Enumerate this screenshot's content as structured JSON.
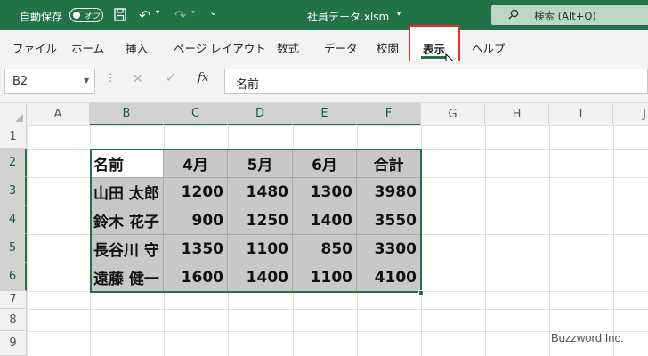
{
  "titlebar": {
    "autosave_label": "自動保存",
    "autosave_state": "オフ",
    "document_title": "社員データ.xlsm",
    "search_text": "検索 (Alt+Q)"
  },
  "ribbon": {
    "tabs": [
      "ファイル",
      "ホーム",
      "挿入",
      "ページ レイアウト",
      "数式",
      "データ",
      "校閲",
      "表示",
      "ヘルプ"
    ],
    "active_tab": "表示"
  },
  "formula_bar": {
    "name_box": "B2",
    "fx_label": "fx",
    "value": "名前"
  },
  "sheet": {
    "columns": [
      "A",
      "B",
      "C",
      "D",
      "E",
      "F",
      "G",
      "H",
      "I",
      "J"
    ],
    "rows": [
      "1",
      "2",
      "3",
      "4",
      "5",
      "6",
      "7",
      "8",
      "9"
    ],
    "table": {
      "header": [
        "名前",
        "4月",
        "5月",
        "6月",
        "合計"
      ],
      "rows": [
        [
          "山田 太郎",
          "1200",
          "1480",
          "1300",
          "3980"
        ],
        [
          "鈴木 花子",
          "900",
          "1250",
          "1400",
          "3550"
        ],
        [
          "長谷川 守",
          "1350",
          "1100",
          "850",
          "3300"
        ],
        [
          "遠藤 健一",
          "1600",
          "1400",
          "1100",
          "4100"
        ]
      ]
    }
  },
  "colors": {
    "excel_green": "#217346",
    "highlight_red": "#e52e2e",
    "table_gray": "#c8c8c8"
  },
  "watermark": "Buzzword Inc."
}
